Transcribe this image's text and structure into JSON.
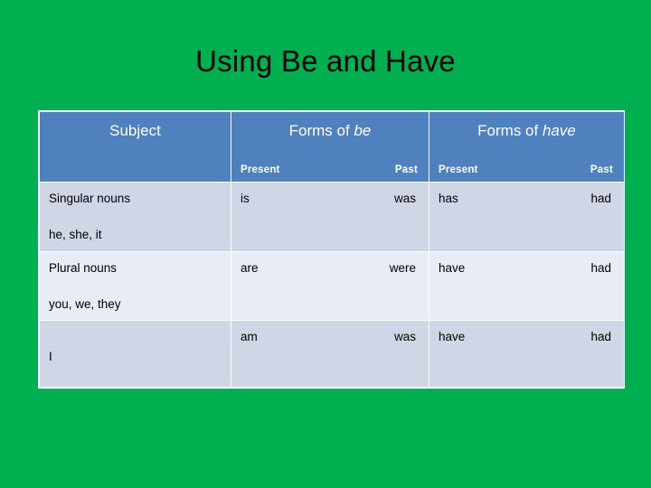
{
  "slide": {
    "title": "Using Be and Have",
    "background_color": "#00af50",
    "header_color": "#4e81bd",
    "row_dark_color": "#cfd7e6",
    "row_light_color": "#e8ecf4",
    "text_color": "#000000",
    "header_text_color": "#ffffff"
  },
  "table": {
    "headers": [
      {
        "label_prefix": "Subject",
        "label_italic": ""
      },
      {
        "label_prefix": "Forms of ",
        "label_italic": "be"
      },
      {
        "label_prefix": "Forms of ",
        "label_italic": "have"
      }
    ],
    "subheaders": {
      "present": "Present",
      "past": "Past"
    },
    "rows": [
      {
        "subject_line1": "Singular nouns",
        "subject_line2": "he, she, it",
        "be_present": "is",
        "be_past": "was",
        "have_present": "has",
        "have_past": "had"
      },
      {
        "subject_line1": "Plural nouns",
        "subject_line2": "you, we, they",
        "be_present": "are",
        "be_past": "were",
        "have_present": "have",
        "have_past": "had"
      },
      {
        "subject_line1": "",
        "subject_line2": "I",
        "be_present": "am",
        "be_past": "was",
        "have_present": "have",
        "have_past": "had"
      }
    ]
  }
}
